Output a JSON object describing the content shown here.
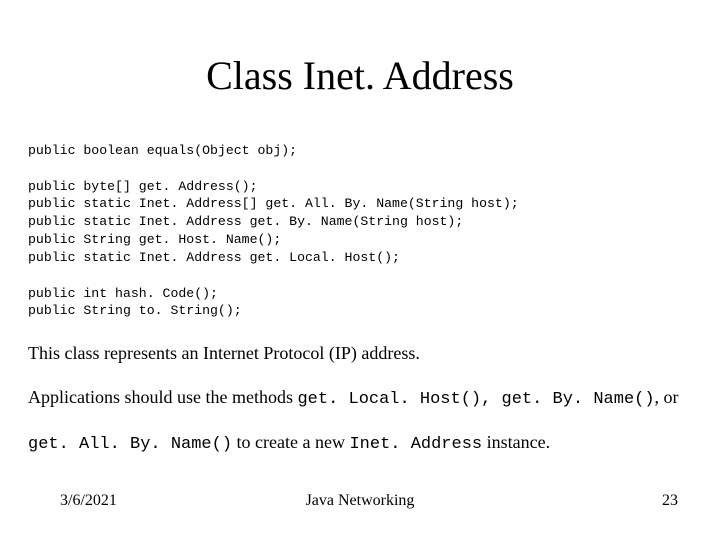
{
  "title": "Class Inet. Address",
  "code": "public boolean equals(Object obj);\n\npublic byte[] get. Address();\npublic static Inet. Address[] get. All. By. Name(String host);\npublic static Inet. Address get. By. Name(String host);\npublic String get. Host. Name();\npublic static Inet. Address get. Local. Host();\n\npublic int hash. Code();\npublic String to. String();",
  "body": {
    "p1": "This class represents an Internet Protocol (IP) address.",
    "p2a": "Applications should use the methods ",
    "p2b": "get. Local. Host(), get. By. Name()",
    "p2c": ", or",
    "p3a": "get. All. By. Name()",
    "p3b": " to create a new ",
    "p3c": "Inet. Address",
    "p3d": " instance."
  },
  "footer": {
    "date": "3/6/2021",
    "title": "Java Networking",
    "page": "23"
  }
}
